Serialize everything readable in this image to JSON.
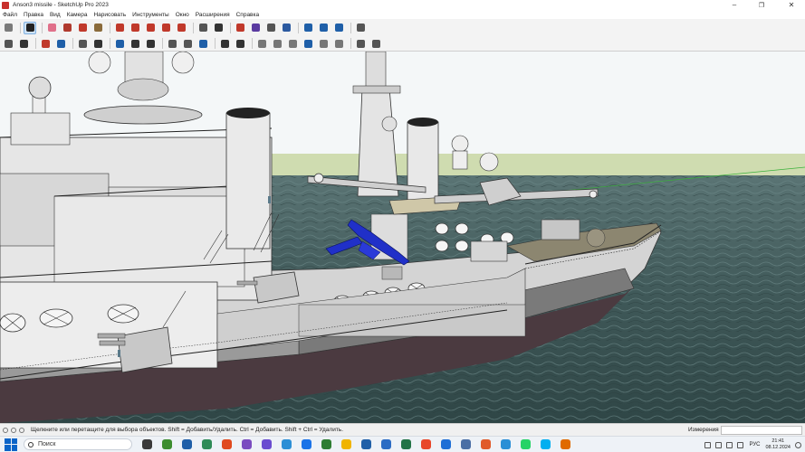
{
  "window": {
    "title": "Anson3 missile - SketchUp Pro 2023",
    "minimize_glyph": "–",
    "maximize_glyph": "❐",
    "close_glyph": "✕"
  },
  "menu": [
    "Файл",
    "Правка",
    "Вид",
    "Камера",
    "Нарисовать",
    "Инструменты",
    "Окно",
    "Расширения",
    "Справка"
  ],
  "toolbar_top": [
    {
      "icon": "zoom-search-icon",
      "color": "#7a7a7a"
    },
    {
      "icon": "select-arrow-icon",
      "color": "#222222",
      "active": true
    },
    {
      "icon": "eraser-icon",
      "color": "#e0708a"
    },
    {
      "icon": "pencil-line-icon",
      "color": "#b03a2e"
    },
    {
      "icon": "shapes-icon",
      "color": "#c0392b"
    },
    {
      "icon": "paint-bucket-icon",
      "color": "#8a6a3a"
    },
    {
      "icon": "push-pull-icon",
      "color": "#c0392b"
    },
    {
      "icon": "move-icon",
      "color": "#c0392b"
    },
    {
      "icon": "rotate-icon",
      "color": "#c0392b"
    },
    {
      "icon": "scale-icon",
      "color": "#c0392b"
    },
    {
      "icon": "offset-icon",
      "color": "#c0392b"
    },
    {
      "icon": "tape-measure-icon",
      "color": "#555555"
    },
    {
      "icon": "text-icon",
      "color": "#333333"
    },
    {
      "icon": "orbit-icon",
      "color": "#c0392b"
    },
    {
      "icon": "pan-icon",
      "color": "#5a3aa0"
    },
    {
      "icon": "zoom-icon",
      "color": "#555555"
    },
    {
      "icon": "zoom-extents-icon",
      "color": "#2c5aa0"
    },
    {
      "icon": "warehouse-icon",
      "color": "#1f5fa8"
    },
    {
      "icon": "extension-icon",
      "color": "#1f5fa8"
    },
    {
      "icon": "layout-icon",
      "color": "#1f5fa8"
    },
    {
      "icon": "account-icon",
      "color": "#555555"
    }
  ],
  "toolbar_second": [
    {
      "icon": "open-folder-icon",
      "color": "#555555"
    },
    {
      "icon": "settings-gear-icon",
      "color": "#333333"
    },
    {
      "icon": "no-entry-icon",
      "color": "#c0392b"
    },
    {
      "icon": "cloud-sync-icon",
      "color": "#1f5fa8"
    },
    {
      "icon": "cube-icon",
      "color": "#555555"
    },
    {
      "icon": "hatch-icon",
      "color": "#333333"
    },
    {
      "icon": "drop-icon",
      "color": "#1f5fa8"
    },
    {
      "icon": "cube-outline-icon",
      "color": "#333333"
    },
    {
      "icon": "layers-icon",
      "color": "#333333"
    },
    {
      "icon": "cloud-upload-icon",
      "color": "#555555"
    },
    {
      "icon": "cloud-download-icon",
      "color": "#555555"
    },
    {
      "icon": "cloud-blue-icon",
      "color": "#1f5fa8"
    },
    {
      "icon": "dot-icon",
      "color": "#333333"
    },
    {
      "icon": "line-dots-icon",
      "color": "#333333"
    },
    {
      "icon": "hex-icon",
      "color": "#777777"
    },
    {
      "icon": "hex-icon",
      "color": "#777777"
    },
    {
      "icon": "hex-icon",
      "color": "#777777"
    },
    {
      "icon": "hex-blue-icon",
      "color": "#1f5fa8"
    },
    {
      "icon": "hex-icon",
      "color": "#777777"
    },
    {
      "icon": "hex-icon",
      "color": "#777777"
    },
    {
      "icon": "cloud-icon",
      "color": "#555555"
    },
    {
      "icon": "cloud-icon",
      "color": "#555555"
    }
  ],
  "status": {
    "text": "Щелкните или перетащите для выбора объектов. Shift = Добавить/Удалить. Ctrl = Добавить. Shift + Ctrl = Удалить.",
    "measurements_label": "Измерения"
  },
  "taskbar": {
    "search_placeholder": "Поиск",
    "apps": [
      "#3a3a3a",
      "#3c8d2f",
      "#1f5fa8",
      "#2e8b57",
      "#e04a1f",
      "#7a4cc0",
      "#6a4cd0",
      "#2c8fd6",
      "#1a73e8",
      "#2d7d32",
      "#f0b400",
      "#1f5fa8",
      "#2b6cc4",
      "#217346",
      "#e8472a",
      "#1f6fd6",
      "#4a6fa5",
      "#e05a2a",
      "#2a8fd6",
      "#25d366",
      "#00aff0",
      "#e06a00"
    ],
    "lang": "РУС",
    "time": "21:41",
    "date": "08.12.2024"
  },
  "colors": {
    "sky": "#f4f7f8",
    "ground": "#cfdcb0",
    "water": "#3f5858",
    "hull": "#d2d2d2",
    "hull_dark": "#6e6e6e",
    "deck": "#8c8670",
    "missile": "#2030c8"
  }
}
